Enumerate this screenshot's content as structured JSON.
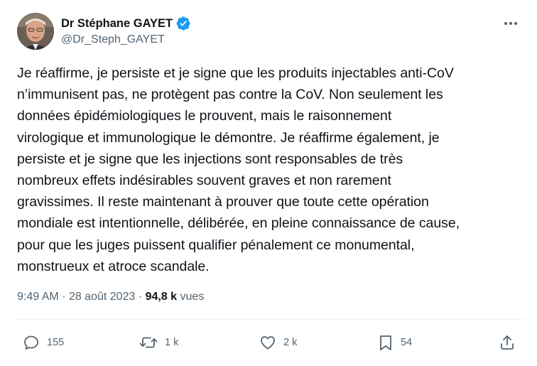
{
  "author": {
    "display_name": "Dr Stéphane GAYET",
    "handle": "@Dr_Steph_GAYET",
    "verified": true,
    "avatar_icon": "profile-photo"
  },
  "tweet": {
    "text": "Je réaffirme, je persiste et je signe que les produits injectables anti-CoV\nn’immunisent pas, ne protègent pas contre la CoV. Non seulement les\ndonnées épidémiologiques le prouvent, mais le raisonnement\nvirologique et immunologique le démontre. Je réaffirme également, je\npersiste et je signe que les injections sont responsables de très\nnombreux effets indésirables souvent graves et non rarement\ngravissimes. Il reste maintenant à prouver que toute cette opération\nmondiale est intentionnelle, délibérée, en pleine connaissance de cause,\npour que les juges puissent qualifier pénalement ce monumental,\nmonstrueux et atroce scandale.",
    "time": "9:49 AM",
    "separator": "·",
    "date": "28 août 2023",
    "views_count": "94,8 k",
    "views_label": "vues"
  },
  "actions": {
    "replies": "155",
    "reposts": "1 k",
    "likes": "2 k",
    "bookmarks": "54"
  },
  "colors": {
    "text_primary": "#0f1419",
    "text_secondary": "#536471",
    "verified_blue": "#1d9bf0",
    "divider": "#eff3f4"
  }
}
